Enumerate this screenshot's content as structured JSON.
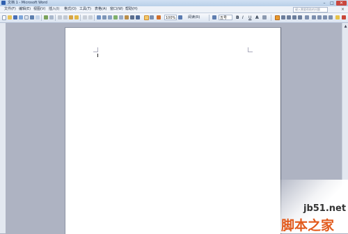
{
  "window": {
    "title": "文档 1 - Microsoft Word",
    "minimize_glyph": "–",
    "maximize_glyph": "□",
    "close_glyph": "✕"
  },
  "menu": {
    "items": [
      "文件(F)",
      "编辑(E)",
      "视图(V)",
      "插入(I)",
      "格式(O)",
      "工具(T)",
      "表格(A)",
      "窗口(W)",
      "帮助(H)"
    ],
    "help_placeholder": "键入需要帮助的问题",
    "close_glyph": "×"
  },
  "toolbar": {
    "zoom": "100%",
    "read_label": "阅读(R)",
    "style_value": "五号",
    "bold": "B",
    "italic": "I",
    "underline": "U",
    "font_color": "A"
  },
  "scroll": {
    "up": "▲",
    "down": "▼"
  },
  "watermark": {
    "domain": "jb51.net",
    "brand": "脚本之家"
  }
}
